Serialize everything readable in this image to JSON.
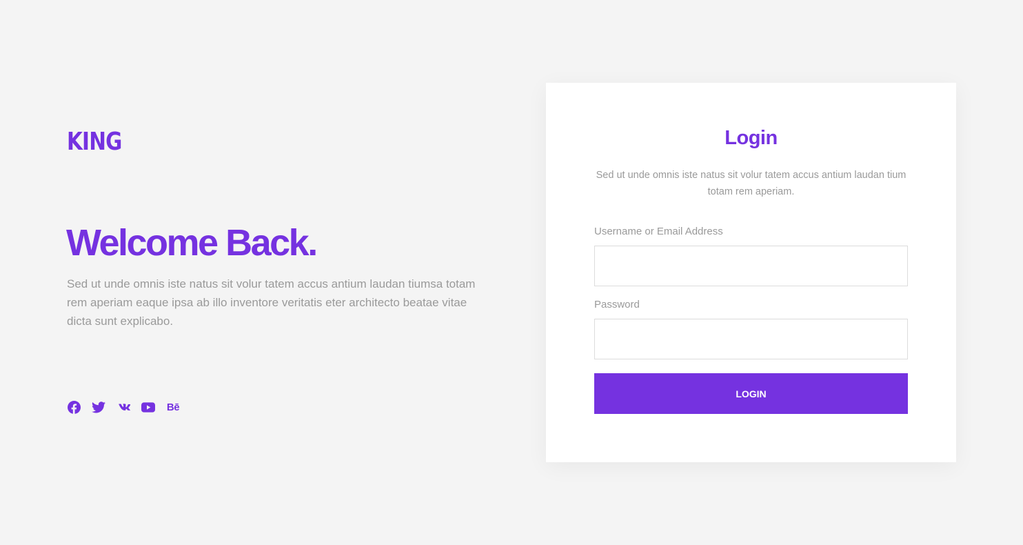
{
  "brand": {
    "logo_text": "KING",
    "accent_color": "#7532e0"
  },
  "hero": {
    "headline": "Welcome Back.",
    "intro": "Sed ut unde omnis iste natus sit volur tatem accus antium laudan tiumsa totam rem aperiam eaque ipsa ab illo inventore veritatis eter architecto beatae vitae dicta sunt explicabo."
  },
  "socials": [
    {
      "icon": "facebook-icon"
    },
    {
      "icon": "twitter-icon"
    },
    {
      "icon": "vk-icon"
    },
    {
      "icon": "youtube-icon"
    },
    {
      "icon": "behance-icon",
      "label": "Bē"
    }
  ],
  "login_card": {
    "title": "Login",
    "subtitle": "Sed ut unde omnis iste natus sit volur tatem accus antium laudan tium totam rem aperiam.",
    "username_label": "Username or Email Address",
    "username_value": "",
    "password_label": "Password",
    "password_value": "",
    "submit_label": "LOGIN"
  }
}
